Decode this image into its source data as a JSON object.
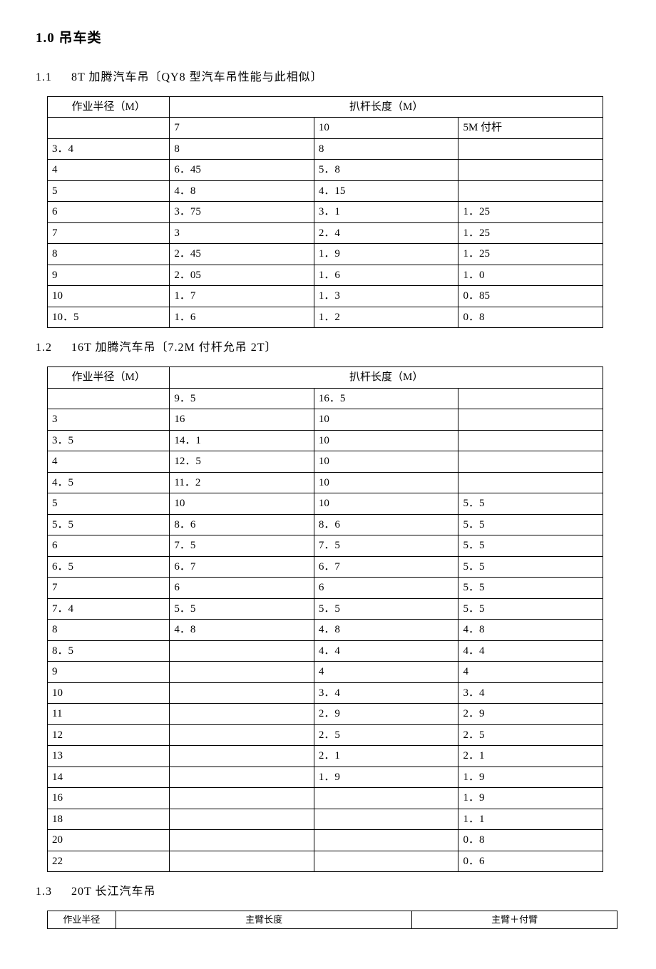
{
  "headings": {
    "main": "1.0 吊车类",
    "s1_num": "1.1",
    "s1_title": "8T 加腾汽车吊〔QY8 型汽车吊性能与此相似〕",
    "s2_num": "1.2",
    "s2_title": "16T 加腾汽车吊〔7.2M 付杆允吊 2T〕",
    "s3_num": "1.3",
    "s3_title": "20T 长江汽车吊"
  },
  "t1": {
    "h_radius": "作业半径（M）",
    "h_boom": "扒杆长度（M）",
    "sub": [
      "7",
      "10",
      "5M 付杆"
    ],
    "rows": [
      [
        "3．4",
        "8",
        "8",
        ""
      ],
      [
        "4",
        "6．45",
        "5．8",
        ""
      ],
      [
        "5",
        "4．8",
        "4．15",
        ""
      ],
      [
        "6",
        "3．75",
        "3．1",
        "1．25"
      ],
      [
        "7",
        "3",
        "2．4",
        "1．25"
      ],
      [
        "8",
        "2．45",
        "1．9",
        "1．25"
      ],
      [
        "9",
        "2．05",
        "1．6",
        "1．0"
      ],
      [
        "10",
        "1．7",
        "1．3",
        "0．85"
      ],
      [
        "10．5",
        "1．6",
        "1．2",
        "0．8"
      ]
    ]
  },
  "t2": {
    "h_radius": "作业半径（M）",
    "h_boom": "扒杆长度（M）",
    "sub": [
      "9．5",
      "16．5",
      ""
    ],
    "rows": [
      [
        "3",
        "16",
        "10",
        ""
      ],
      [
        "3．5",
        "14．1",
        "10",
        ""
      ],
      [
        "4",
        "12．5",
        "10",
        ""
      ],
      [
        "4．5",
        "11．2",
        "10",
        ""
      ],
      [
        "5",
        "10",
        "10",
        "5．5"
      ],
      [
        "5．5",
        "8．6",
        "8．6",
        "5．5"
      ],
      [
        "6",
        "7．5",
        "7．5",
        "5．5"
      ],
      [
        "6．5",
        "6．7",
        "6．7",
        "5．5"
      ],
      [
        "7",
        "6",
        "6",
        "5．5"
      ],
      [
        "7．4",
        "5．5",
        "5．5",
        "5．5"
      ],
      [
        "8",
        "4．8",
        "4．8",
        "4．8"
      ],
      [
        "8．5",
        "",
        "4．4",
        "4．4"
      ],
      [
        "9",
        "",
        "4",
        "4"
      ],
      [
        "10",
        "",
        "3．4",
        "3．4"
      ],
      [
        "11",
        "",
        "2．9",
        "2．9"
      ],
      [
        "12",
        "",
        "2．5",
        "2．5"
      ],
      [
        "13",
        "",
        "2．1",
        "2．1"
      ],
      [
        "14",
        "",
        "1．9",
        "1．9"
      ],
      [
        "16",
        "",
        "",
        "1．9"
      ],
      [
        "18",
        "",
        "",
        "1．1"
      ],
      [
        "20",
        "",
        "",
        "0．8"
      ],
      [
        "22",
        "",
        "",
        "0．6"
      ]
    ]
  },
  "t3": {
    "h_radius": "作业半径",
    "h_main": "主臂长度",
    "h_aux": "主臂＋付臂"
  }
}
